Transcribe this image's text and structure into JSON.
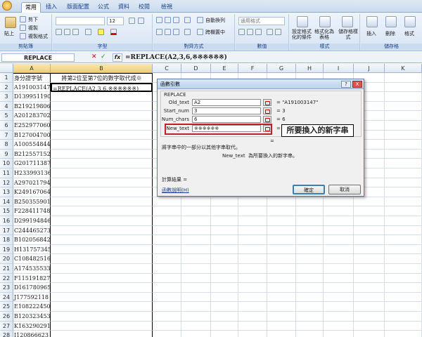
{
  "tabs": [
    "常用",
    "插入",
    "版面配置",
    "公式",
    "資料",
    "校閱",
    "檢視"
  ],
  "ribbon": {
    "paste": "貼上",
    "cut": "剪下",
    "copy": "複製",
    "format_painter": "複製格式",
    "font_size": "12",
    "wrap_text": "自動換列",
    "merge_center": "跨欄置中",
    "number_format": "通用格式",
    "cond_format": "設定格式化的條件",
    "table_format": "格式化為表格",
    "cell_styles": "儲存格樣式",
    "insert": "插入",
    "delete": "刪除",
    "format": "格式",
    "groups": [
      "剪貼簿",
      "字型",
      "對齊方式",
      "數值",
      "樣式",
      "儲存格"
    ]
  },
  "formula_bar": {
    "name_box": "REPLACE",
    "formula": "=REPLACE(A2,3,6,※※※※※※)"
  },
  "columns": [
    "A",
    "B",
    "C",
    "D",
    "E",
    "F",
    "G",
    "H",
    "I",
    "J",
    "K"
  ],
  "rows": [
    {
      "n": "1",
      "a": "身分證字號",
      "b": "將第2位至第7位的數字取代成※"
    },
    {
      "n": "2",
      "a": "A191003147",
      "b": "=REPLACE(A2,3,6,※※※※※※)"
    },
    {
      "n": "3",
      "a": "D139951190",
      "b": ""
    },
    {
      "n": "4",
      "a": "B219219806",
      "b": ""
    },
    {
      "n": "5",
      "a": "A201283702",
      "b": ""
    },
    {
      "n": "6",
      "a": "E252977060",
      "b": ""
    },
    {
      "n": "7",
      "a": "B127004700",
      "b": ""
    },
    {
      "n": "8",
      "a": "A100554844",
      "b": ""
    },
    {
      "n": "9",
      "a": "B212557152",
      "b": ""
    },
    {
      "n": "10",
      "a": "G201711387",
      "b": ""
    },
    {
      "n": "11",
      "a": "H233993136",
      "b": ""
    },
    {
      "n": "12",
      "a": "A297021794",
      "b": ""
    },
    {
      "n": "13",
      "a": "K249167064",
      "b": ""
    },
    {
      "n": "14",
      "a": "B250355901",
      "b": ""
    },
    {
      "n": "15",
      "a": "F228411748",
      "b": ""
    },
    {
      "n": "16",
      "a": "D299194846",
      "b": ""
    },
    {
      "n": "17",
      "a": "C244465273",
      "b": ""
    },
    {
      "n": "18",
      "a": "B102056842",
      "b": ""
    },
    {
      "n": "19",
      "a": "H131757345",
      "b": ""
    },
    {
      "n": "20",
      "a": "C108482516",
      "b": ""
    },
    {
      "n": "21",
      "a": "A174535533",
      "b": ""
    },
    {
      "n": "22",
      "a": "F115191827",
      "b": ""
    },
    {
      "n": "23",
      "a": "D161780965",
      "b": ""
    },
    {
      "n": "24",
      "a": "J177592118",
      "b": ""
    },
    {
      "n": "25",
      "a": "E108222450",
      "b": ""
    },
    {
      "n": "26",
      "a": "B120323453",
      "b": ""
    },
    {
      "n": "27",
      "a": "K163290291",
      "b": ""
    },
    {
      "n": "28",
      "a": "I120866623",
      "b": ""
    }
  ],
  "dialog": {
    "title": "函數引數",
    "function_name": "REPLACE",
    "args": [
      {
        "label": "Old_text",
        "value": "A2",
        "result": "= \"A191003147\""
      },
      {
        "label": "Start_num",
        "value": "3",
        "result": "= 3"
      },
      {
        "label": "Num_chars",
        "value": "6",
        "result": "= 6"
      },
      {
        "label": "New_text",
        "value": "※※※※※※",
        "result": "="
      }
    ],
    "equals_sign": "=",
    "description": "將字串中的一部分以其他字串取代。",
    "arg_help": "New_text  為所要換入的新字串。",
    "result_label": "計算結果 =",
    "help_link": "函數說明(H)",
    "ok": "確定",
    "cancel": "取消",
    "help_btn": "?",
    "close_btn": "X"
  },
  "annotation": "所要換入的新字串",
  "colors": {
    "highlight": "#c0202a",
    "accent": "#15428b"
  }
}
